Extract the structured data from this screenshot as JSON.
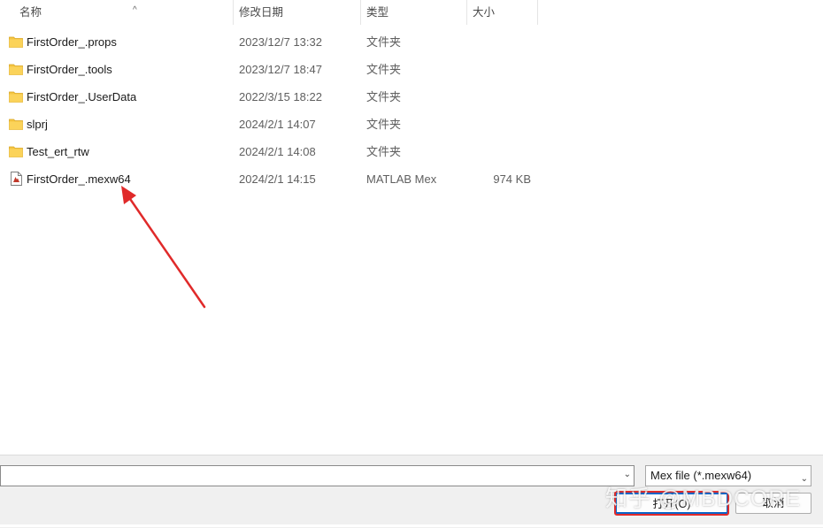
{
  "columns": {
    "name": "名称",
    "date": "修改日期",
    "type": "类型",
    "size": "大小",
    "sort_indicator": "^"
  },
  "files": [
    {
      "name": "FirstOrder_.props",
      "date": "2023/12/7 13:32",
      "type": "文件夹",
      "size": "",
      "icon": "folder-icon"
    },
    {
      "name": "FirstOrder_.tools",
      "date": "2023/12/7 18:47",
      "type": "文件夹",
      "size": "",
      "icon": "folder-icon"
    },
    {
      "name": "FirstOrder_.UserData",
      "date": "2022/3/15 18:22",
      "type": "文件夹",
      "size": "",
      "icon": "folder-icon"
    },
    {
      "name": "slprj",
      "date": "2024/2/1 14:07",
      "type": "文件夹",
      "size": "",
      "icon": "folder-icon"
    },
    {
      "name": "Test_ert_rtw",
      "date": "2024/2/1 14:08",
      "type": "文件夹",
      "size": "",
      "icon": "folder-icon"
    },
    {
      "name": "FirstOrder_.mexw64",
      "date": "2024/2/1 14:15",
      "type": "MATLAB Mex",
      "size": "974 KB",
      "icon": "mex-file-icon"
    }
  ],
  "footer": {
    "filename_value": "",
    "filetype": "Mex file (*.mexw64)",
    "open_label": "打开(O)",
    "cancel_label": "取消"
  },
  "watermark": "知乎 @MBDCORE",
  "colors": {
    "folder": "#f5c542",
    "annotation": "#e02a2a",
    "accent": "#0a64c8"
  }
}
